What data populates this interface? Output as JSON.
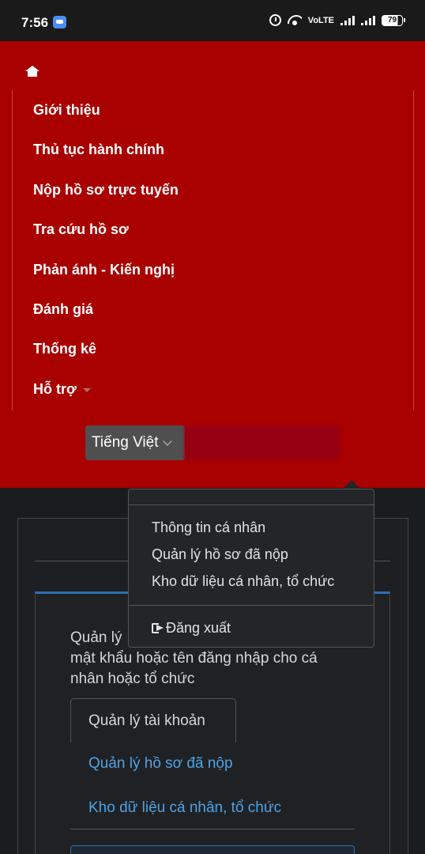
{
  "status_bar": {
    "time": "7:56",
    "network": "VoLTE",
    "battery": "79"
  },
  "nav": {
    "items": [
      {
        "label": "Giới thiệu"
      },
      {
        "label": "Thủ tục hành chính"
      },
      {
        "label": "Nộp hồ sơ trực tuyến"
      },
      {
        "label": "Tra cứu hồ sơ"
      },
      {
        "label": "Phản ánh - Kiến nghị"
      },
      {
        "label": "Đánh giá"
      },
      {
        "label": "Thống kê"
      },
      {
        "label": "Hỗ trợ"
      }
    ],
    "language": "Tiếng Việt"
  },
  "dropdown": {
    "items": [
      {
        "label": "Thông tin cá nhân"
      },
      {
        "label": "Quản lý hồ sơ đã nộp"
      },
      {
        "label": "Kho dữ liệu cá nhân, tổ chức"
      }
    ],
    "logout_label": "Đăng xuất"
  },
  "content": {
    "desc_lines": [
      "Quản lý",
      "mật khẩu hoặc tên đăng nhập cho cá",
      "nhân hoặc tổ chức"
    ],
    "tabs": [
      {
        "label": "Quản lý tài khoản"
      },
      {
        "label": "Quản lý hồ sơ đã nộp"
      },
      {
        "label": "Kho dữ liệu cá nhân, tổ chức"
      }
    ]
  }
}
